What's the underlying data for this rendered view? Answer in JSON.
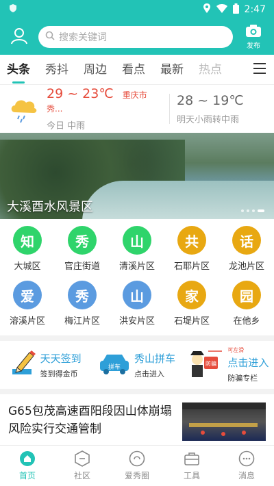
{
  "status": {
    "time": "2:47"
  },
  "header": {
    "search_placeholder": "搜索关键词",
    "publish_label": "发布",
    "accent": "#22c3b6"
  },
  "tabs": [
    {
      "label": "头条",
      "active": true
    },
    {
      "label": "秀抖"
    },
    {
      "label": "周边"
    },
    {
      "label": "看点"
    },
    {
      "label": "最新"
    },
    {
      "label": "热点"
    }
  ],
  "weather": {
    "today_temp": "29 ~ 23℃",
    "city": "重庆市秀...",
    "today_desc": "今日 中雨",
    "tomorrow_temp": "28 ~ 19℃",
    "tomorrow_desc": "明天小雨转中雨"
  },
  "banner": {
    "caption": "大溪酉水风景区"
  },
  "districts": [
    {
      "char": "知",
      "label": "大城区",
      "color": "#2fd46b"
    },
    {
      "char": "秀",
      "label": "官庄街道",
      "color": "#2fd46b"
    },
    {
      "char": "山",
      "label": "清溪片区",
      "color": "#2fd46b"
    },
    {
      "char": "共",
      "label": "石耶片区",
      "color": "#e8a812"
    },
    {
      "char": "话",
      "label": "龙池片区",
      "color": "#e8a812"
    },
    {
      "char": "爱",
      "label": "溶溪片区",
      "color": "#5b9be0"
    },
    {
      "char": "秀",
      "label": "梅江片区",
      "color": "#5b9be0"
    },
    {
      "char": "山",
      "label": "洪安片区",
      "color": "#5b9be0"
    },
    {
      "char": "家",
      "label": "石堤片区",
      "color": "#e8a812"
    },
    {
      "char": "园",
      "label": "在他乡",
      "color": "#e8a812"
    }
  ],
  "services": [
    {
      "title": "天天签到",
      "sub": "签到得金币",
      "icon": "pencil-icon"
    },
    {
      "title": "秀山拼车",
      "sub": "点击进入",
      "icon": "car-icon",
      "badge": "拼车"
    },
    {
      "title": "点击进入",
      "sub": "防骗专栏",
      "icon": "police-icon",
      "sign": "防骗",
      "arrow_text": "可左滑"
    }
  ],
  "news": {
    "title": "G65包茂高速酉阳段因山体崩塌风险实行交通管制"
  },
  "bottom_nav": [
    {
      "label": "首页",
      "active": true
    },
    {
      "label": "社区"
    },
    {
      "label": "爱秀圈"
    },
    {
      "label": "工具"
    },
    {
      "label": "消息"
    }
  ]
}
